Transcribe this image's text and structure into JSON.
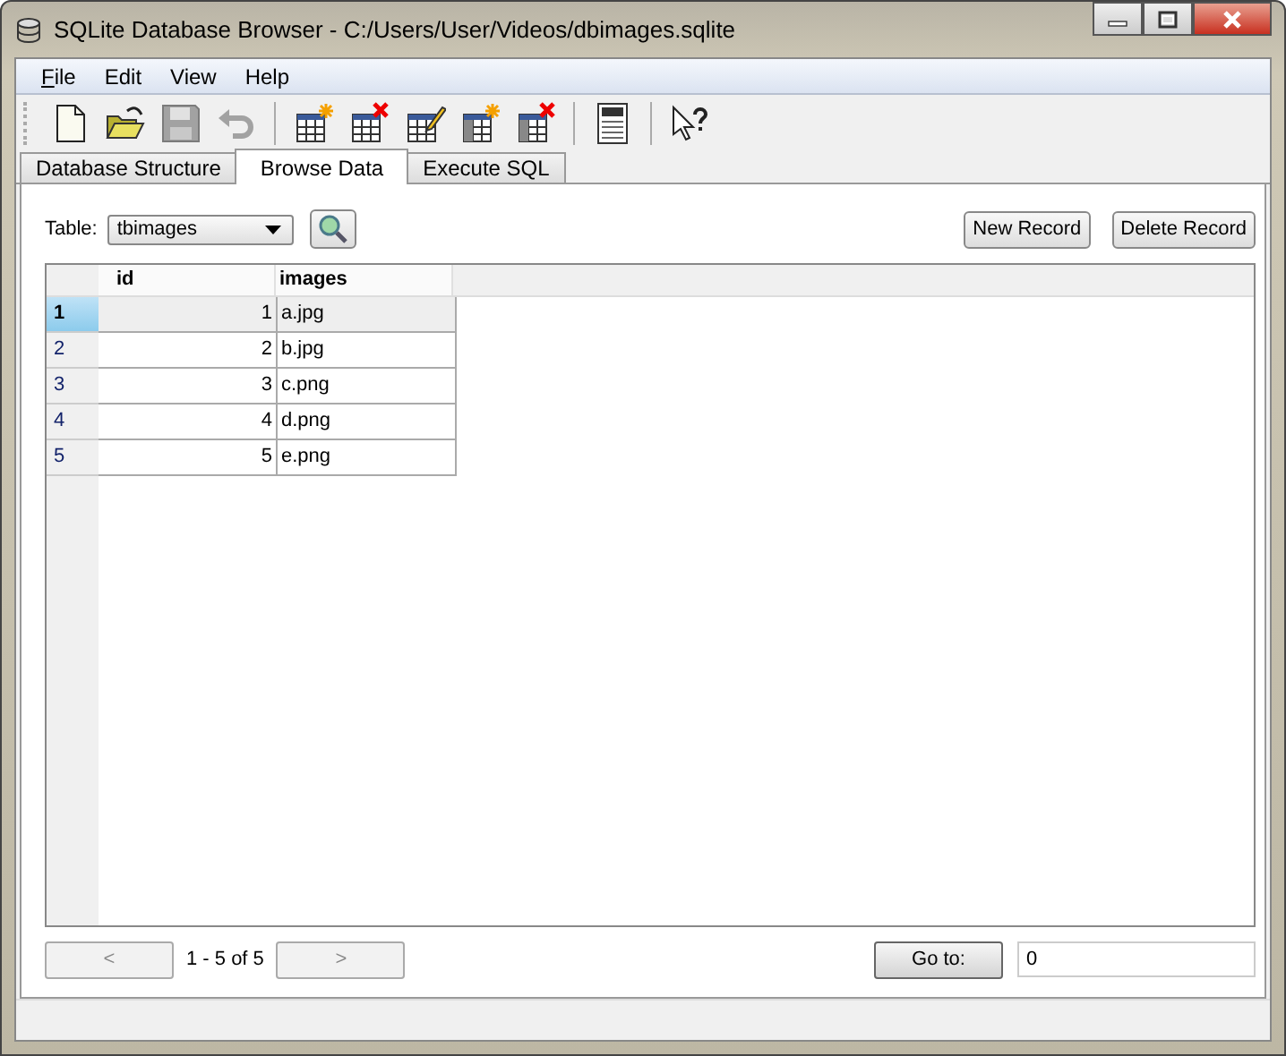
{
  "window": {
    "title": "SQLite Database Browser - C:/Users/User/Videos/dbimages.sqlite"
  },
  "menu": [
    {
      "label": "File"
    },
    {
      "label": "Edit"
    },
    {
      "label": "View"
    },
    {
      "label": "Help"
    }
  ],
  "toolbar": [
    {
      "kind": "new",
      "disabled": false
    },
    {
      "kind": "open",
      "disabled": false
    },
    {
      "kind": "save",
      "disabled": true
    },
    {
      "kind": "undo",
      "disabled": true
    },
    {
      "kind": "sep"
    },
    {
      "kind": "create-table",
      "disabled": false
    },
    {
      "kind": "delete-table",
      "disabled": false
    },
    {
      "kind": "edit-table",
      "disabled": false
    },
    {
      "kind": "create-index",
      "disabled": false
    },
    {
      "kind": "delete-index",
      "disabled": false
    },
    {
      "kind": "sep"
    },
    {
      "kind": "log",
      "disabled": false
    },
    {
      "kind": "sep"
    },
    {
      "kind": "whatsthis",
      "disabled": false
    }
  ],
  "tabs": [
    {
      "label": "Database Structure",
      "selected": false
    },
    {
      "label": "Browse Data",
      "selected": true
    },
    {
      "label": "Execute SQL",
      "selected": false
    }
  ],
  "table_picker": {
    "label": "Table:",
    "value": "tbimages"
  },
  "buttons": [
    "New Record",
    "Delete Record"
  ],
  "table": {
    "columns": [
      "id",
      "images"
    ],
    "rows": [
      {
        "header": "1",
        "cells": [
          "1",
          "a.jpg"
        ],
        "selected": true
      },
      {
        "header": "2",
        "cells": [
          "2",
          "b.jpg"
        ],
        "selected": false
      },
      {
        "header": "3",
        "cells": [
          "3",
          "c.png"
        ],
        "selected": false
      },
      {
        "header": "4",
        "cells": [
          "4",
          "d.png"
        ],
        "selected": false
      },
      {
        "header": "5",
        "cells": [
          "5",
          "e.png"
        ],
        "selected": false
      }
    ]
  },
  "pager": {
    "prev": {
      "label": "<",
      "disabled": true
    },
    "range": "1 - 5 of 5",
    "next": {
      "label": ">",
      "disabled": true
    },
    "goto": {
      "label": "Go to:"
    },
    "goto_value": "0"
  }
}
